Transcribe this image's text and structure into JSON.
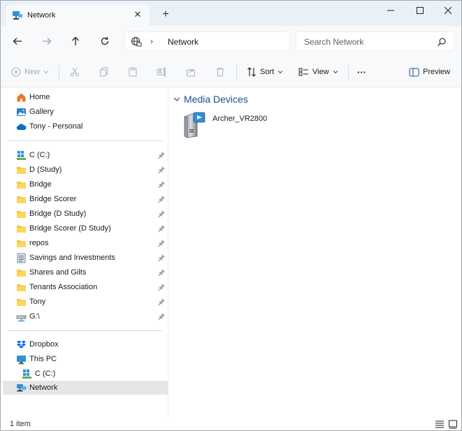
{
  "window": {
    "tab_title": "Network",
    "tab_icon": "network-icon",
    "new_tab_label": "+",
    "controls": [
      "minimize-icon",
      "maximize-icon",
      "close-icon"
    ]
  },
  "nav": {
    "back_icon": "arrow-left-icon",
    "forward_icon": "arrow-right-icon",
    "up_icon": "arrow-up-icon",
    "refresh_icon": "refresh-icon"
  },
  "address": {
    "crumb": "Network",
    "separator": "›"
  },
  "search": {
    "placeholder": "Search Network"
  },
  "commands": {
    "new_label": "New",
    "sort_label": "Sort",
    "view_label": "View",
    "more_label": "···",
    "preview_label": "Preview"
  },
  "sidebar": {
    "top": [
      {
        "label": "Home",
        "icon": "home-icon"
      },
      {
        "label": "Gallery",
        "icon": "gallery-icon"
      },
      {
        "label": "Tony - Personal",
        "icon": "cloud-icon"
      }
    ],
    "pinned": [
      {
        "label": "C (C:)",
        "icon": "drive-icon"
      },
      {
        "label": "D (Study)",
        "icon": "folder-icon"
      },
      {
        "label": "Bridge",
        "icon": "folder-icon"
      },
      {
        "label": "Bridge Scorer",
        "icon": "folder-icon"
      },
      {
        "label": "Bridge (D Study)",
        "icon": "folder-icon"
      },
      {
        "label": "Bridge Scorer (D Study)",
        "icon": "folder-icon"
      },
      {
        "label": "repos",
        "icon": "folder-icon"
      },
      {
        "label": "Savings and Investments",
        "icon": "document-icon"
      },
      {
        "label": "Shares and Gilts",
        "icon": "folder-icon"
      },
      {
        "label": "Tenants Association",
        "icon": "folder-icon"
      },
      {
        "label": "Tony",
        "icon": "folder-icon"
      },
      {
        "label": "G:\\",
        "icon": "network-drive-icon"
      }
    ],
    "bottom": [
      {
        "label": "Dropbox",
        "icon": "dropbox-icon"
      },
      {
        "label": "This PC",
        "icon": "monitor-icon"
      },
      {
        "label": "C (C:)",
        "icon": "drive-icon"
      },
      {
        "label": "Network",
        "icon": "network-icon"
      }
    ]
  },
  "content": {
    "group_label": "Media Devices",
    "items": [
      {
        "label": "Archer_VR2800",
        "icon": "media-device-icon"
      }
    ]
  },
  "status": {
    "item_count": "1 item"
  },
  "colors": {
    "titlebar": "#e9f0f6",
    "toolbar": "#f7f9fb",
    "accent": "#1e4f8a",
    "selected": "#e4e6e8"
  }
}
